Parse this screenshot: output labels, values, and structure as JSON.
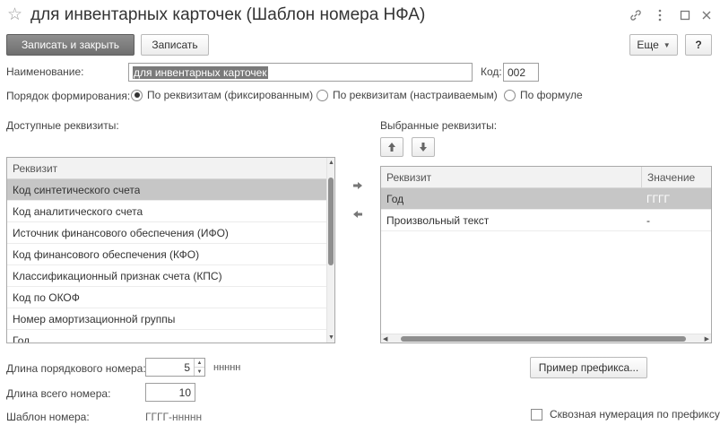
{
  "window": {
    "title": "для инвентарных карточек (Шаблон номера НФА)",
    "icons": [
      "star-icon",
      "link-icon",
      "more-icon",
      "maximize-icon",
      "close-icon"
    ]
  },
  "toolbar": {
    "save_close_label": "Записать и закрыть",
    "save_label": "Записать",
    "more_label": "Еще",
    "help_label": "?"
  },
  "form": {
    "name_label": "Наименование:",
    "name_value": "для инвентарных карточек",
    "code_label": "Код:",
    "code_value": "002",
    "order_label": "Порядок формирования:",
    "order_options": [
      {
        "label": "По реквизитам (фиксированным)",
        "selected": true
      },
      {
        "label": "По реквизитам (настраиваемым)",
        "selected": false
      },
      {
        "label": "По формуле",
        "selected": false
      }
    ]
  },
  "available": {
    "title": "Доступные реквизиты:",
    "column_header": "Реквизит",
    "rows": [
      "Код синтетического счета",
      "Код аналитического счета",
      "Источник финансового обеспечения (ИФО)",
      "Код финансового обеспечения (КФО)",
      "Классификационный признак счета (КПС)",
      "Код по ОКОФ",
      "Номер амортизационной группы",
      "Год"
    ],
    "selected_index": 0
  },
  "selected": {
    "title": "Выбранные реквизиты:",
    "column_header": "Реквизит",
    "value_header": "Значение",
    "rows": [
      {
        "name": "Год",
        "value": "ГГГГ"
      },
      {
        "name": "Произвольный текст",
        "value": "-"
      }
    ],
    "selected_index": 0
  },
  "bottom": {
    "seq_length_label": "Длина порядкового номера:",
    "seq_length_value": "5",
    "seq_mask": "ннннн",
    "total_length_label": "Длина всего номера:",
    "total_length_value": "10",
    "template_label": "Шаблон номера:",
    "template_value": "ГГГГ-ннннн",
    "prefix_example_label": "Пример префикса...",
    "through_numbering_label": "Сквозная нумерация по префиксу",
    "through_numbering_checked": false
  }
}
